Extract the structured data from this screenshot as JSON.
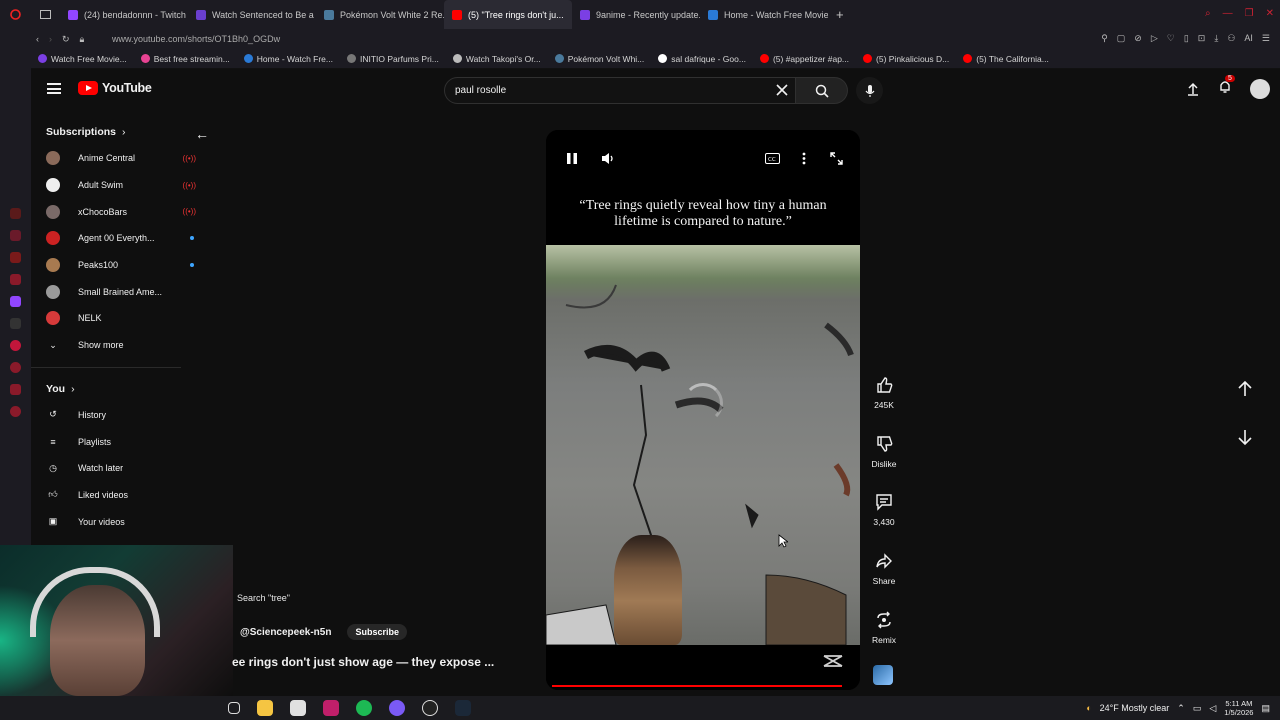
{
  "browser": {
    "tabs": [
      {
        "label": "(24) bendadonnn - Twitch",
        "color": "#9146ff"
      },
      {
        "label": "Watch Sentenced to Be a ...",
        "color": "#6a3fcf"
      },
      {
        "label": "Pokémon Volt White 2 Re...",
        "color": "#4a7a9c"
      },
      {
        "label": "(5) \"Tree rings don't ju...",
        "color": "#ff0000",
        "active": true
      },
      {
        "label": "9anime - Recently update...",
        "color": "#7b3fe4"
      },
      {
        "label": "Home - Watch Free Movie...",
        "color": "#2a7ad6"
      }
    ],
    "url": "www.youtube.com/shorts/OT1Bh0_OGDw",
    "bookmarks": [
      {
        "label": "Watch Free Movie...",
        "color": "#7b3fe4"
      },
      {
        "label": "Best free streamin...",
        "color": "#e84393"
      },
      {
        "label": "Home - Watch Fre...",
        "color": "#2a7ad6"
      },
      {
        "label": "INITIO Parfums Pri...",
        "color": "#777777"
      },
      {
        "label": "Watch Takopi's Or...",
        "color": "#bbbbbb"
      },
      {
        "label": "Pokémon Volt Whi...",
        "color": "#4a7a9c"
      },
      {
        "label": "sal dafrique - Goo...",
        "color": "#ffffff"
      },
      {
        "label": "(5) #appetizer #ap...",
        "color": "#ff0000"
      },
      {
        "label": "(5) Pinkalicious D...",
        "color": "#ff0000"
      },
      {
        "label": "(5) The California...",
        "color": "#ff0000"
      }
    ]
  },
  "yt": {
    "logo_text": "YouTube",
    "search_value": "paul rosolle",
    "notifications_count": "5",
    "sidebar": {
      "subscriptions_label": "Subscriptions",
      "channels": [
        {
          "name": "Anime Central",
          "color": "#8a6a5a",
          "badge": "live"
        },
        {
          "name": "Adult Swim",
          "color": "#eeeeee",
          "badge": "live"
        },
        {
          "name": "xChocoBars",
          "color": "#7a6a68",
          "badge": "live"
        },
        {
          "name": "Agent 00 Everyth...",
          "color": "#cc2222",
          "badge": "new"
        },
        {
          "name": "Peaks100",
          "color": "#a87a50",
          "badge": "new"
        },
        {
          "name": "Small Brained Ame...",
          "color": "#9a9a9a",
          "badge": ""
        },
        {
          "name": "NELK",
          "color": "#d63a3a",
          "badge": ""
        }
      ],
      "show_more": "Show more",
      "you_label": "You",
      "you_items": [
        {
          "label": "History",
          "icon": "history-icon"
        },
        {
          "label": "Playlists",
          "icon": "playlists-icon"
        },
        {
          "label": "Watch later",
          "icon": "watch-later-icon"
        },
        {
          "label": "Liked videos",
          "icon": "liked-videos-icon"
        },
        {
          "label": "Your videos",
          "icon": "your-videos-icon"
        }
      ]
    },
    "short": {
      "quote": "“Tree rings quietly reveal how tiny a human lifetime is compared to nature.”",
      "search_hint": "Search \"tree\"",
      "channel": "@Sciencepeek-n5n",
      "subscribe": "Subscribe",
      "title": "ee rings don't just show age — they expose ...",
      "actions": [
        {
          "label": "245K",
          "icon": "like-icon"
        },
        {
          "label": "Dislike",
          "icon": "dislike-icon"
        },
        {
          "label": "3,430",
          "icon": "comments-icon"
        },
        {
          "label": "Share",
          "icon": "share-icon"
        },
        {
          "label": "Remix",
          "icon": "remix-icon"
        }
      ]
    }
  },
  "taskbar": {
    "weather": "24°F  Mostly clear",
    "time": "5:11 AM",
    "date": "1/5/2026"
  }
}
